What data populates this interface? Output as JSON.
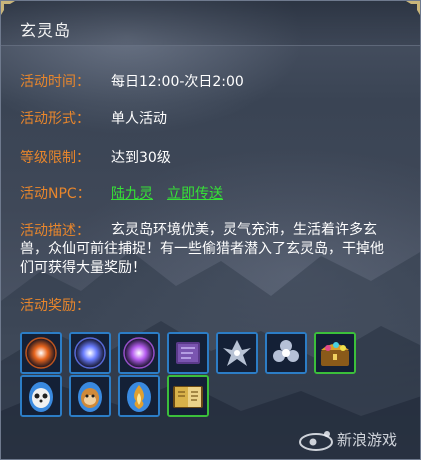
{
  "window": {
    "title": "玄灵岛"
  },
  "rows": {
    "time": {
      "label": "活动时间：",
      "value": "每日12:00-次日2:00"
    },
    "form": {
      "label": "活动形式：",
      "value": "单人活动"
    },
    "level": {
      "label": "等级限制：",
      "value": "达到30级"
    },
    "npc": {
      "label": "活动NPC：",
      "name": "陆九灵",
      "teleport": "立即传送"
    },
    "desc": {
      "label": "活动描述：",
      "text": "玄灵岛环境优美，灵气充沛，生活着许多玄兽，众仙可前往捕捉！有一些偷猎者潜入了玄灵岛，干掉他们可获得大量奖励！"
    },
    "reward": {
      "label": "活动奖励："
    }
  },
  "rewards": [
    {
      "icon": "fire-orb-icon",
      "color": "#e8641c"
    },
    {
      "icon": "blue-orb-icon",
      "color": "#6a7dff"
    },
    {
      "icon": "purple-orb-icon",
      "color": "#b65cf0"
    },
    {
      "icon": "purple-book-icon",
      "color": "#5a3a8a"
    },
    {
      "icon": "silver-fairy-icon",
      "color": "#c9d4e6"
    },
    {
      "icon": "silver-blossom-icon",
      "color": "#b5c0d6"
    },
    {
      "icon": "treasure-chest-icon",
      "color": "#d9a02a"
    },
    {
      "icon": "panda-egg-icon",
      "color": "#f0f0f0"
    },
    {
      "icon": "monkey-egg-icon",
      "color": "#d08a3a"
    },
    {
      "icon": "flame-egg-icon",
      "color": "#e0a030"
    },
    {
      "icon": "golden-book-icon",
      "color": "#d8b24a"
    }
  ],
  "watermark": {
    "text": "新浪游戏",
    "logo": "sina"
  }
}
